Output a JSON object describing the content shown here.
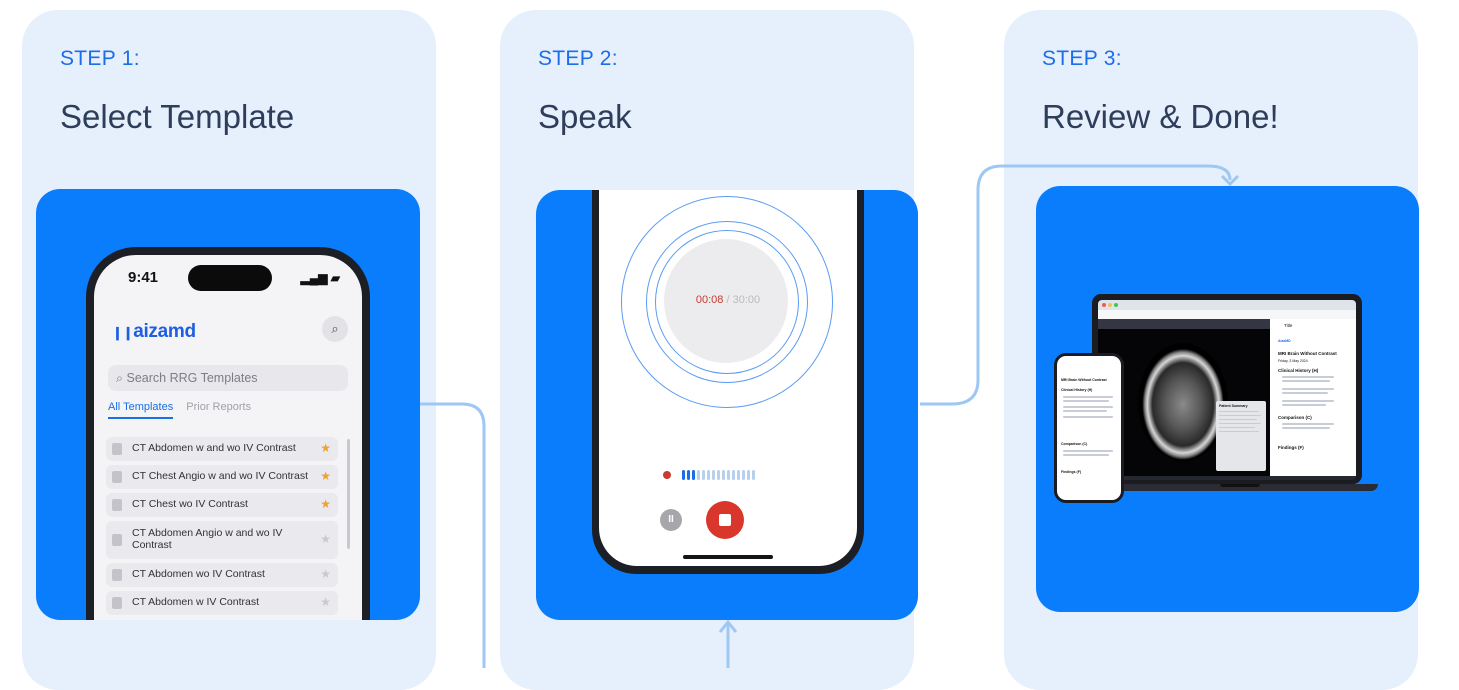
{
  "steps": [
    {
      "label": "STEP 1:",
      "title": "Select Template"
    },
    {
      "label": "STEP 2:",
      "title": "Speak"
    },
    {
      "label": "STEP 3:",
      "title": "Review & Done!"
    }
  ],
  "colors": {
    "card_bg": "#e6effc",
    "panel_bg": "#0a7dfd",
    "accent": "#1a6ee8",
    "title_text": "#2e3d59",
    "flow_line": "#9ec8f4",
    "record_red": "#d9372c"
  },
  "step1": {
    "status_time": "9:41",
    "app_logo": "aizamd",
    "search_icon": "search-icon",
    "search_placeholder": "Search RRG Templates",
    "tabs": [
      "All Templates",
      "Prior Reports"
    ],
    "templates": [
      {
        "name": "CT Abdomen w and wo IV Contrast",
        "favorite": true
      },
      {
        "name": "CT Chest Angio w and wo IV Contrast",
        "favorite": true
      },
      {
        "name": "CT Chest  wo IV Contrast",
        "favorite": true
      },
      {
        "name": "CT Abdomen Angio w and wo IV Contrast",
        "favorite": false
      },
      {
        "name": "CT Abdomen wo IV Contrast",
        "favorite": false
      },
      {
        "name": "CT Abdomen w IV Contrast",
        "favorite": false
      }
    ]
  },
  "step2": {
    "elapsed": "00:08",
    "total": "/ 30:00",
    "pause_icon": "pause-icon",
    "stop_icon": "stop-icon"
  },
  "step3": {
    "report_title": "MRI Brain Without Contrast",
    "report_date": "Friday, 3 May 2024",
    "sections": [
      "Clinical History (H)",
      "Comparison (C)",
      "Findings (F)"
    ],
    "popup_title": "Patient Summary",
    "panel_header": "Title",
    "brand": "AizaMD"
  }
}
